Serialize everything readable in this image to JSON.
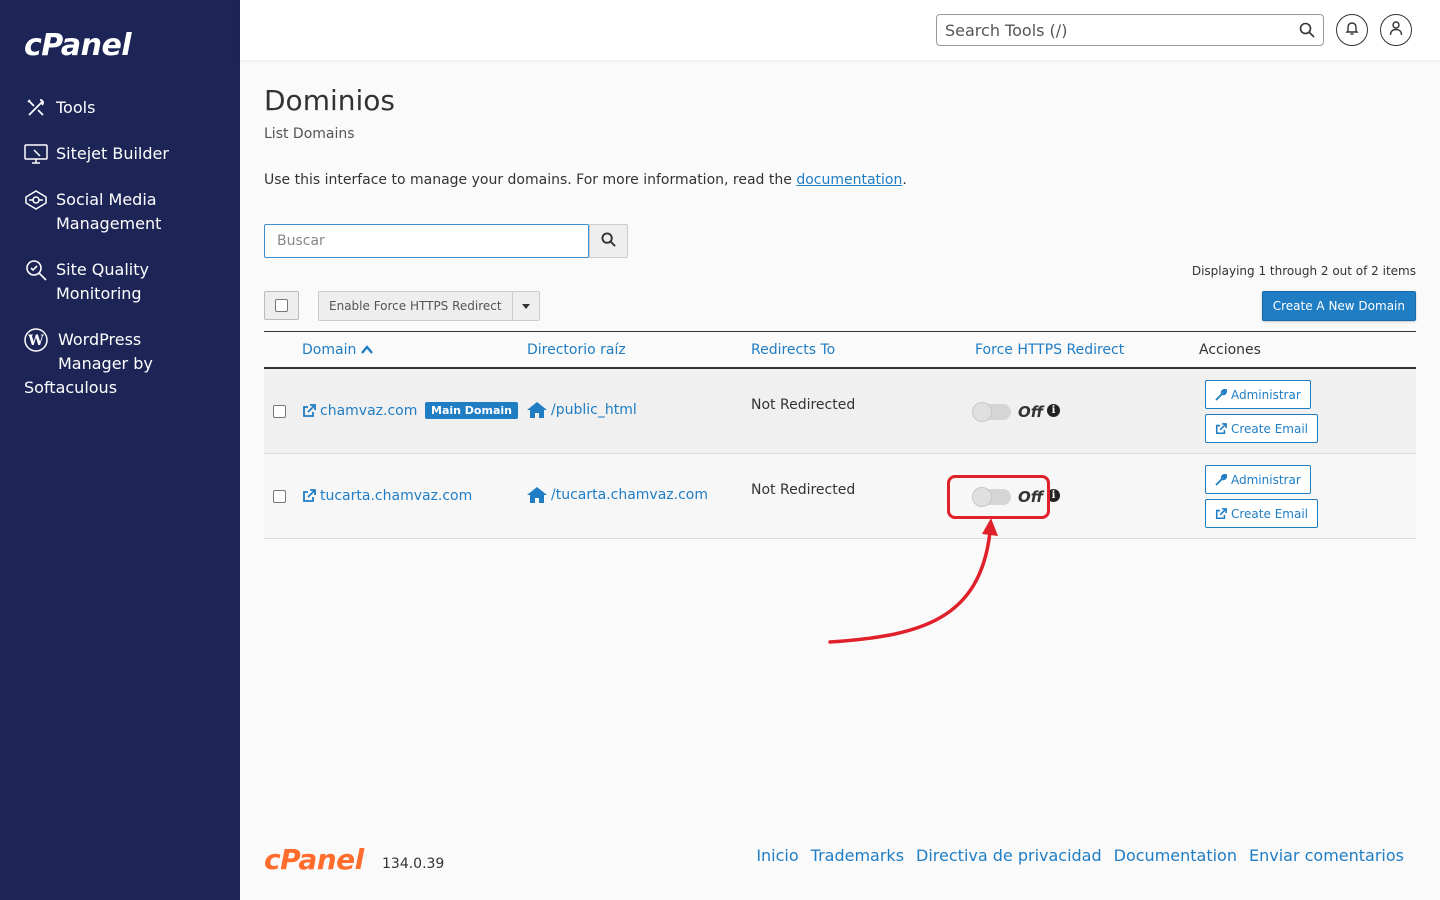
{
  "brand": {
    "logo_text": "cPanel",
    "version": "134.0.39"
  },
  "sidebar": {
    "items": [
      {
        "label": "Tools",
        "icon": "tools-icon"
      },
      {
        "label": "Sitejet Builder",
        "icon": "sitejet-icon"
      },
      {
        "label": "Social Media Management",
        "line1": "Social Media",
        "line2": "Management",
        "icon": "social-media-icon"
      },
      {
        "label": "Site Quality Monitoring",
        "line1": "Site Quality",
        "line2": "Monitoring",
        "icon": "site-quality-icon"
      },
      {
        "label": "WordPress Manager by Softaculous",
        "line1": "WordPress",
        "line2": "Manager by",
        "line3": "Softaculous",
        "icon": "wordpress-icon"
      }
    ]
  },
  "topbar": {
    "search_placeholder": "Search Tools (/)"
  },
  "page": {
    "title": "Dominios",
    "subtitle": "List Domains",
    "description_prefix": "Use this interface to manage your domains. For more information, read the ",
    "description_link": "documentation",
    "description_suffix": "."
  },
  "search": {
    "placeholder": "Buscar"
  },
  "toolbar": {
    "display_info": "Displaying 1 through 2 out of 2 items",
    "bulk_action": "Enable Force HTTPS Redirect",
    "create_label": "Create A New Domain"
  },
  "table": {
    "headers": [
      "Domain",
      "Directorio raíz",
      "Redirects To",
      "Force HTTPS Redirect",
      "Acciones"
    ],
    "rows": [
      {
        "domain": "chamvaz.com",
        "badge": "Main Domain",
        "dir": "/public_html",
        "redirect": "Not Redirected",
        "https": "Off",
        "btn_admin": "Administrar",
        "btn_email": "Create Email"
      },
      {
        "domain": "tucarta.chamvaz.com",
        "dir": "/tucarta.chamvaz.com",
        "redirect": "Not Redirected",
        "https": "Off",
        "btn_admin": "Administrar",
        "btn_email": "Create Email"
      }
    ]
  },
  "footer": {
    "links": [
      "Inicio",
      "Trademarks",
      "Directiva de privacidad",
      "Documentation",
      "Enviar comentarios"
    ]
  },
  "colors": {
    "sidebar": "#1d2556",
    "accent": "#1f7dc4",
    "footer_logo": "#ff6c2c",
    "annotation": "#e0202a"
  }
}
